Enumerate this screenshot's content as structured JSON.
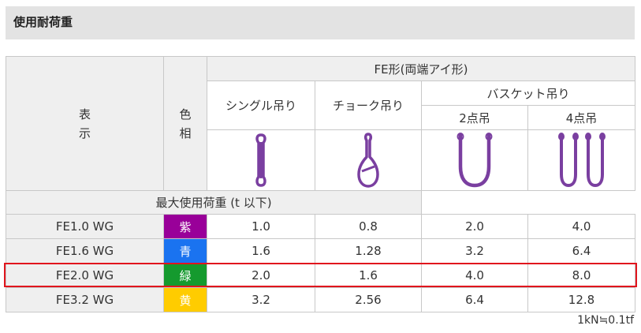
{
  "section": {
    "title": "使用耐荷重"
  },
  "table": {
    "col_display": [
      "表",
      "示"
    ],
    "col_color": [
      "色",
      "相"
    ],
    "group_header": "FE形(両端アイ形)",
    "sub_single": "シングル吊り",
    "sub_choke": "チョーク吊り",
    "sub_basket": "バスケット吊り",
    "sub_basket_2": "2点吊",
    "sub_basket_4": "4点吊",
    "load_caption": "最大使用荷重 (t 以下)",
    "rows": [
      {
        "name": "FE1.0 WG",
        "color_label": "紫",
        "color": "#990099",
        "single": "1.0",
        "choke": "0.8",
        "basket2": "2.0",
        "basket4": "4.0"
      },
      {
        "name": "FE1.6 WG",
        "color_label": "青",
        "color": "#1a73f0",
        "single": "1.6",
        "choke": "1.28",
        "basket2": "3.2",
        "basket4": "6.4"
      },
      {
        "name": "FE2.0 WG",
        "color_label": "緑",
        "color": "#159a2e",
        "single": "2.0",
        "choke": "1.6",
        "basket2": "4.0",
        "basket4": "8.0"
      },
      {
        "name": "FE3.2 WG",
        "color_label": "黄",
        "color": "#ffcc00",
        "single": "3.2",
        "choke": "2.56",
        "basket2": "6.4",
        "basket4": "12.8"
      }
    ]
  },
  "footnote": "1kN≒0.1tf",
  "style": {
    "sling_color": "#7a3fa0",
    "highlight_color": "#e1151d"
  },
  "icons": [
    "sling-single-icon",
    "sling-choke-icon",
    "sling-basket-2-icon",
    "sling-basket-4-icon"
  ]
}
